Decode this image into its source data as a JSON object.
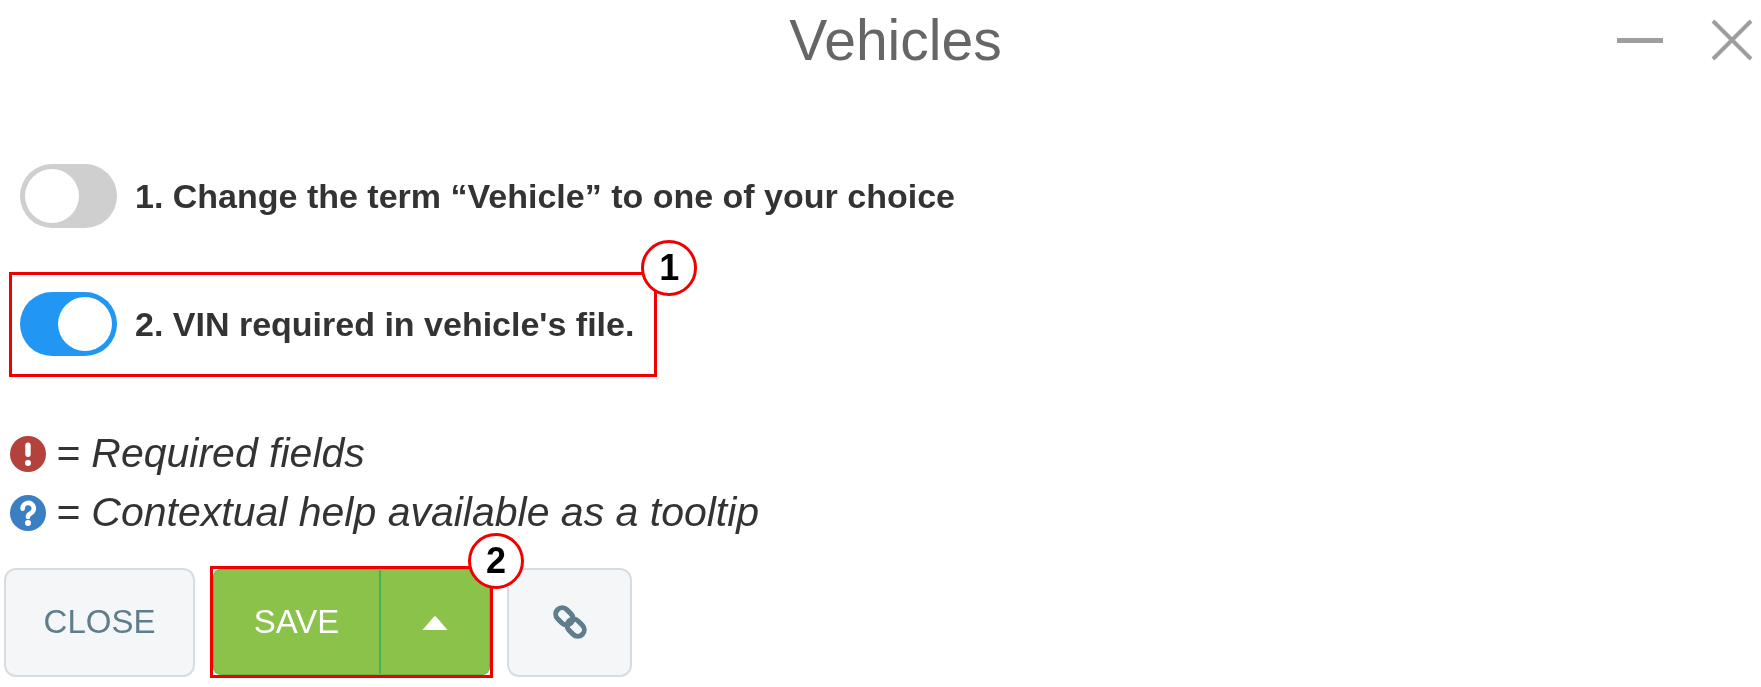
{
  "window": {
    "title": "Vehicles"
  },
  "options": [
    {
      "label": "1. Change the term “Vehicle” to one of your choice",
      "on": false
    },
    {
      "label": "2. VIN required in vehicle's file.",
      "on": true,
      "callout": "1"
    }
  ],
  "legend": [
    {
      "kind": "required",
      "text": "= Required fields"
    },
    {
      "kind": "help",
      "text": "= Contextual help available as a tooltip"
    }
  ],
  "buttons": [
    {
      "kind": "close",
      "label": "CLOSE"
    },
    {
      "kind": "save",
      "label": "SAVE",
      "callout": "2"
    },
    {
      "kind": "link"
    }
  ]
}
